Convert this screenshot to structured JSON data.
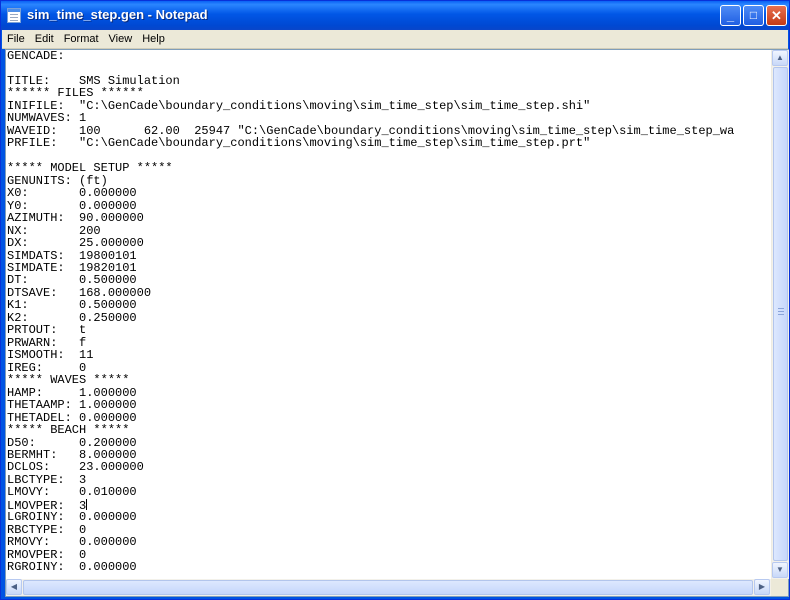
{
  "window": {
    "title": "sim_time_step.gen - Notepad",
    "minimize_glyph": "_",
    "maximize_glyph": "□",
    "close_glyph": "✕"
  },
  "menu": [
    "File",
    "Edit",
    "Format",
    "View",
    "Help"
  ],
  "editor": {
    "caret_line": 37,
    "lines": [
      "GENCADE:",
      "",
      "TITLE:    SMS Simulation",
      "****** FILES ******",
      "INIFILE:  \"C:\\GenCade\\boundary_conditions\\moving\\sim_time_step\\sim_time_step.shi\"",
      "NUMWAVES: 1",
      "WAVEID:   100      62.00  25947 \"C:\\GenCade\\boundary_conditions\\moving\\sim_time_step\\sim_time_step_wa",
      "PRFILE:   \"C:\\GenCade\\boundary_conditions\\moving\\sim_time_step\\sim_time_step.prt\"",
      "",
      "***** MODEL SETUP *****",
      "GENUNITS: (ft)",
      "X0:       0.000000",
      "Y0:       0.000000",
      "AZIMUTH:  90.000000",
      "NX:       200",
      "DX:       25.000000",
      "SIMDATS:  19800101",
      "SIMDATE:  19820101",
      "DT:       0.500000",
      "DTSAVE:   168.000000",
      "K1:       0.500000",
      "K2:       0.250000",
      "PRTOUT:   t",
      "PRWARN:   f",
      "ISMOOTH:  11",
      "IREG:     0",
      "***** WAVES *****",
      "HAMP:     1.000000",
      "THETAAMP: 1.000000",
      "THETADEL: 0.000000",
      "***** BEACH *****",
      "D50:      0.200000",
      "BERMHT:   8.000000",
      "DCLOS:    23.000000",
      "LBCTYPE:  3",
      "LMOVY:    0.010000",
      "LMOVPER:  3",
      "LGROINY:  0.000000",
      "RBCTYPE:  0",
      "RMOVY:    0.000000",
      "RMOVPER:  0",
      "RGROINY:  0.000000"
    ]
  },
  "scrollbars": {
    "up_arrow": "▲",
    "down_arrow": "▼",
    "left_arrow": "◀",
    "right_arrow": "▶"
  },
  "colors": {
    "titlebar": "#0054e3",
    "menubar": "#ece9d8",
    "close_button": "#c43b17"
  }
}
